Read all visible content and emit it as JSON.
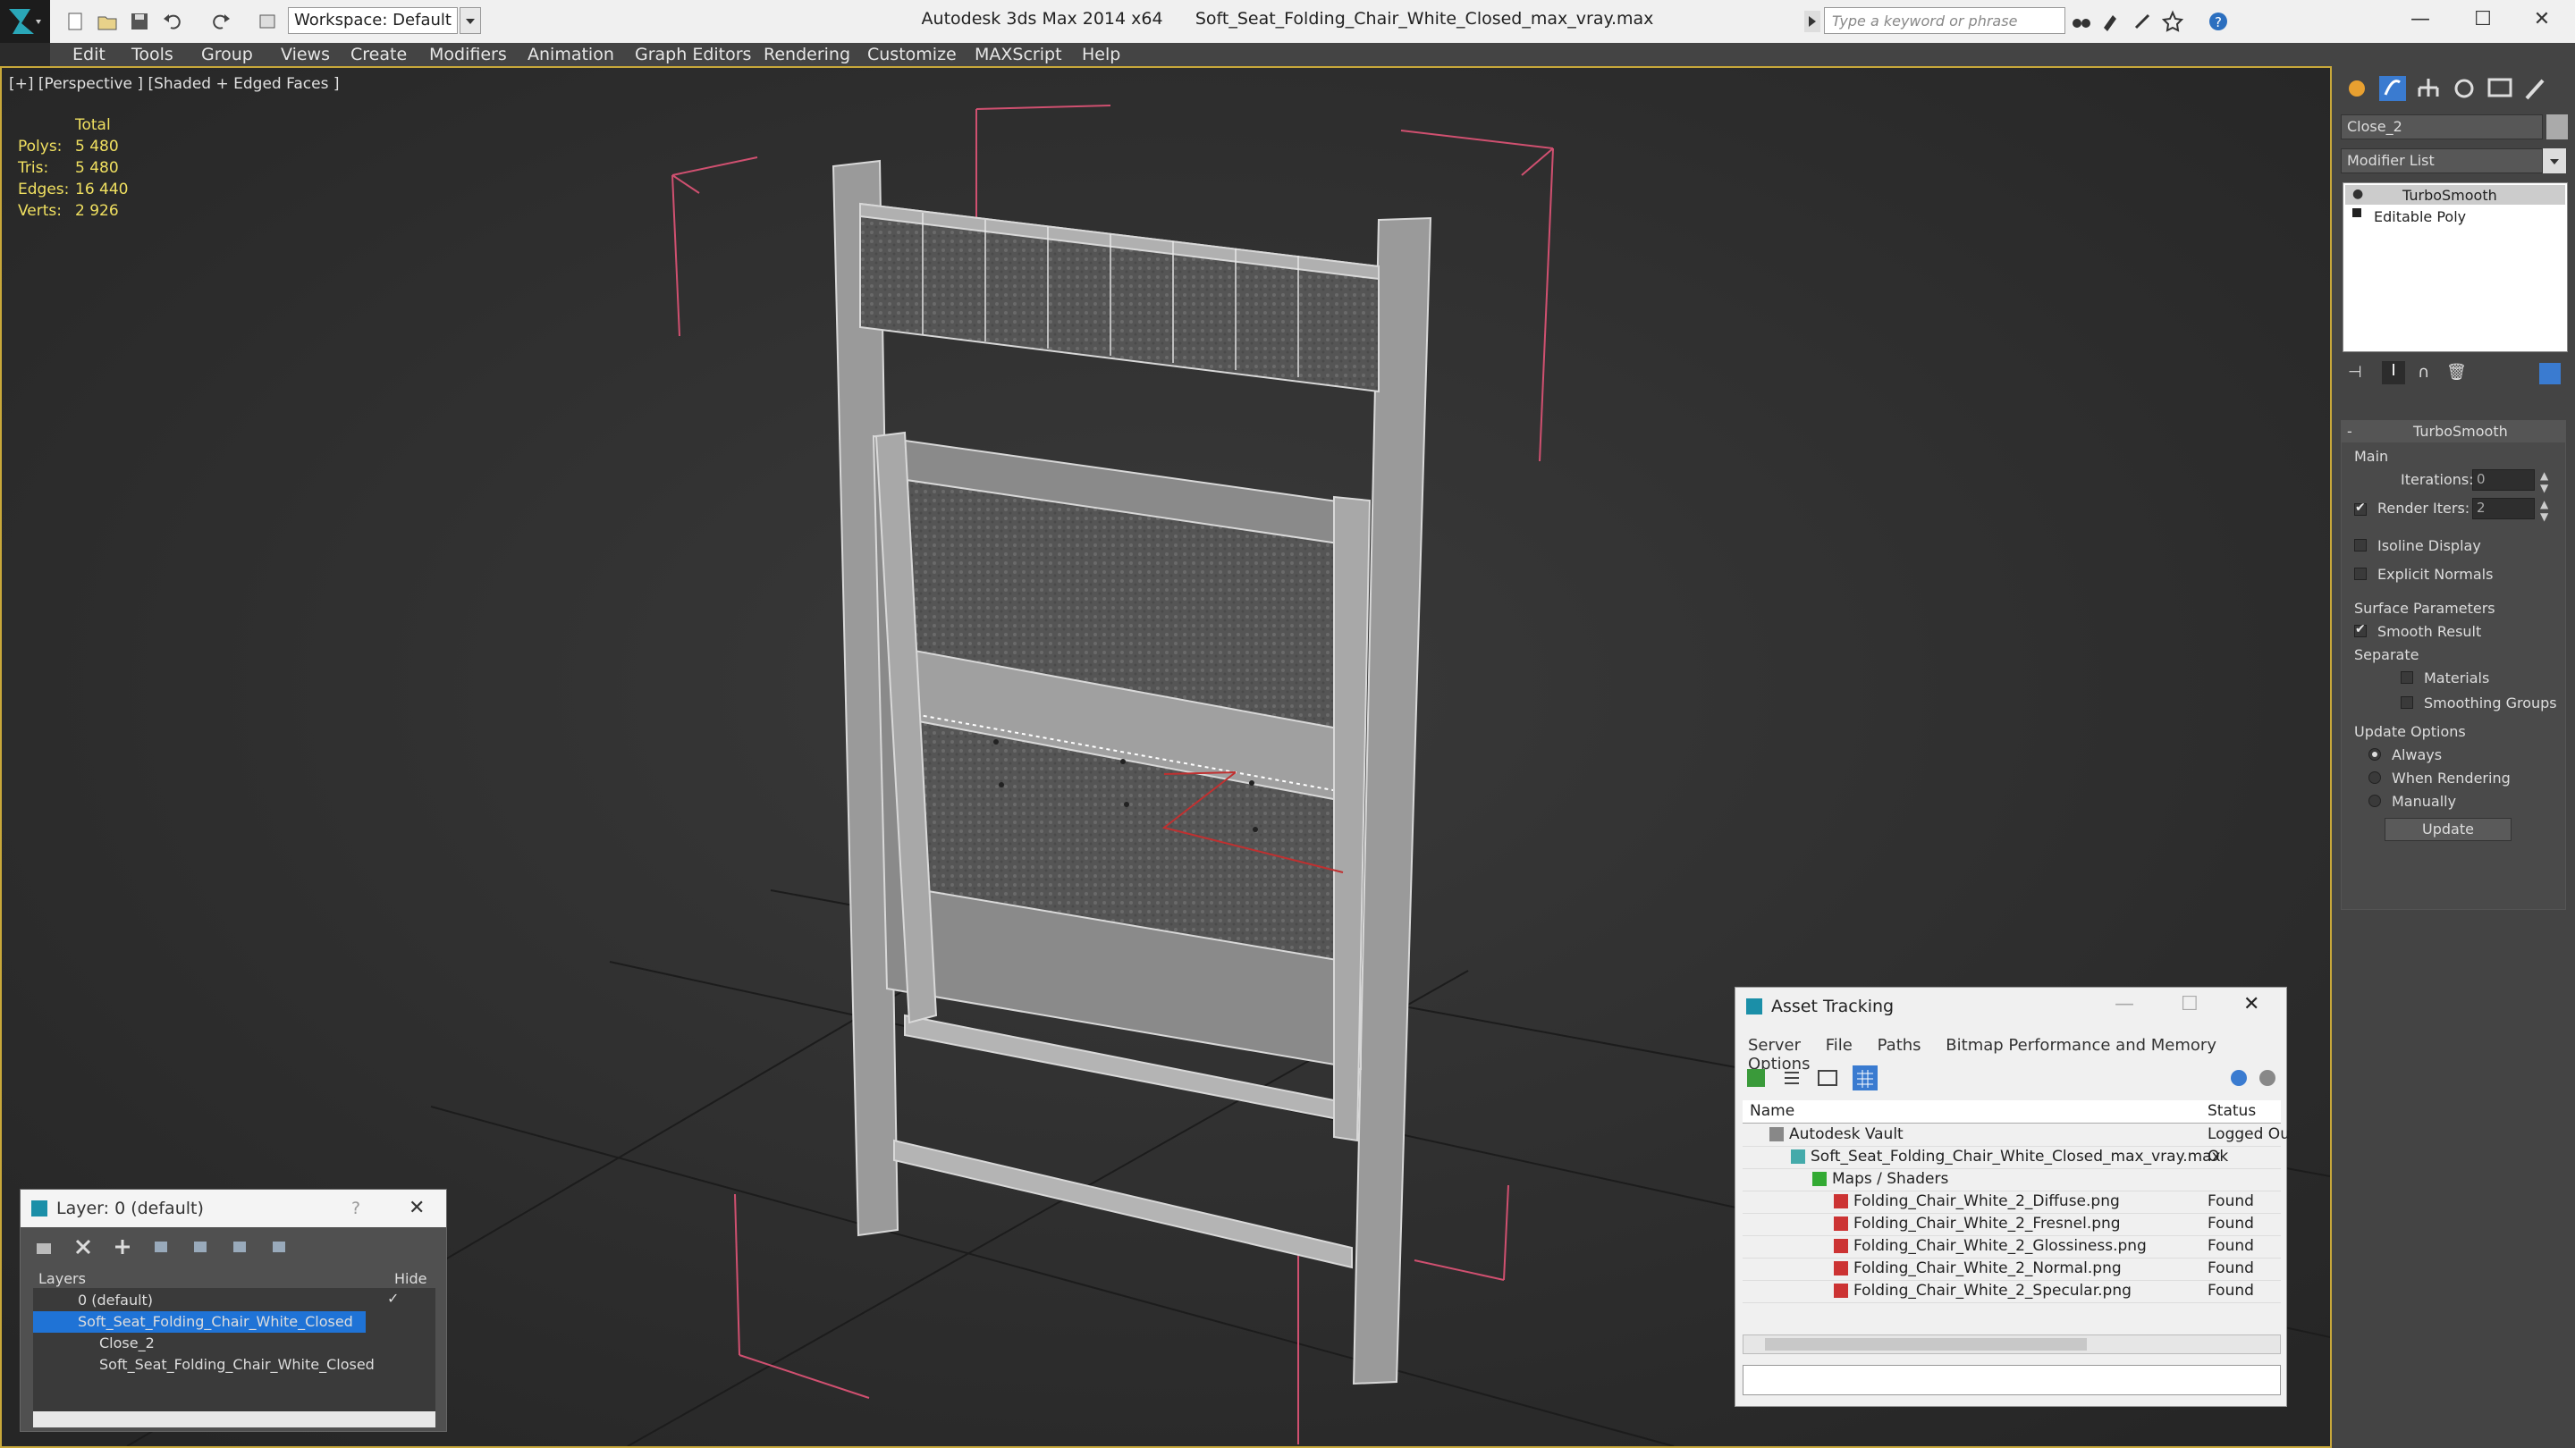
{
  "titlebar": {
    "app": "Autodesk 3ds Max  2014 x64",
    "file": "Soft_Seat_Folding_Chair_White_Closed_max_vray.max",
    "workspace": "Workspace: Default",
    "search_placeholder": "Type a keyword or phrase"
  },
  "menu": [
    "Edit",
    "Tools",
    "Group",
    "Views",
    "Create",
    "Modifiers",
    "Animation",
    "Graph Editors",
    "Rendering",
    "Customize",
    "MAXScript",
    "Help"
  ],
  "viewport": {
    "label": "[+] [Perspective ] [Shaded + Edged Faces ]",
    "stats": {
      "header": "Total",
      "rows": [
        {
          "k": "Polys:",
          "v": "5 480"
        },
        {
          "k": "Tris:",
          "v": "5 480"
        },
        {
          "k": "Edges:",
          "v": "16 440"
        },
        {
          "k": "Verts:",
          "v": "2 926"
        }
      ]
    }
  },
  "command_panel": {
    "object_name": "Close_2",
    "modifier_list": "Modifier List",
    "stack": [
      "TurboSmooth",
      "Editable Poly"
    ],
    "rollout_title": "TurboSmooth",
    "main_label": "Main",
    "iterations_label": "Iterations:",
    "iterations_value": "0",
    "render_iters_label": "Render Iters:",
    "render_iters_value": "2",
    "isoline": "Isoline Display",
    "explicit_normals": "Explicit Normals",
    "surface_params": "Surface Parameters",
    "smooth_result": "Smooth Result",
    "separate": "Separate",
    "materials": "Materials",
    "smoothing_groups": "Smoothing Groups",
    "update_options": "Update Options",
    "always": "Always",
    "when_rendering": "When Rendering",
    "manually": "Manually",
    "update_btn": "Update"
  },
  "layer_window": {
    "title": "Layer: 0 (default)",
    "help": "?",
    "col_layers": "Layers",
    "col_hide": "Hide",
    "rows": [
      {
        "label": "0 (default)"
      },
      {
        "label": "Soft_Seat_Folding_Chair_White_Closed"
      },
      {
        "label": "Close_2"
      },
      {
        "label": "Soft_Seat_Folding_Chair_White_Closed"
      }
    ]
  },
  "asset_window": {
    "title": "Asset Tracking",
    "menu": [
      "Server",
      "File",
      "Paths",
      "Bitmap Performance and Memory",
      "Options"
    ],
    "col_name": "Name",
    "col_status": "Status",
    "rows": [
      {
        "name": "Autodesk Vault",
        "status": "Logged Ou"
      },
      {
        "name": "Soft_Seat_Folding_Chair_White_Closed_max_vray.max",
        "status": "Ok"
      },
      {
        "name": "Maps / Shaders",
        "status": ""
      },
      {
        "name": "Folding_Chair_White_2_Diffuse.png",
        "status": "Found"
      },
      {
        "name": "Folding_Chair_White_2_Fresnel.png",
        "status": "Found"
      },
      {
        "name": "Folding_Chair_White_2_Glossiness.png",
        "status": "Found"
      },
      {
        "name": "Folding_Chair_White_2_Normal.png",
        "status": "Found"
      },
      {
        "name": "Folding_Chair_White_2_Specular.png",
        "status": "Found"
      }
    ]
  }
}
